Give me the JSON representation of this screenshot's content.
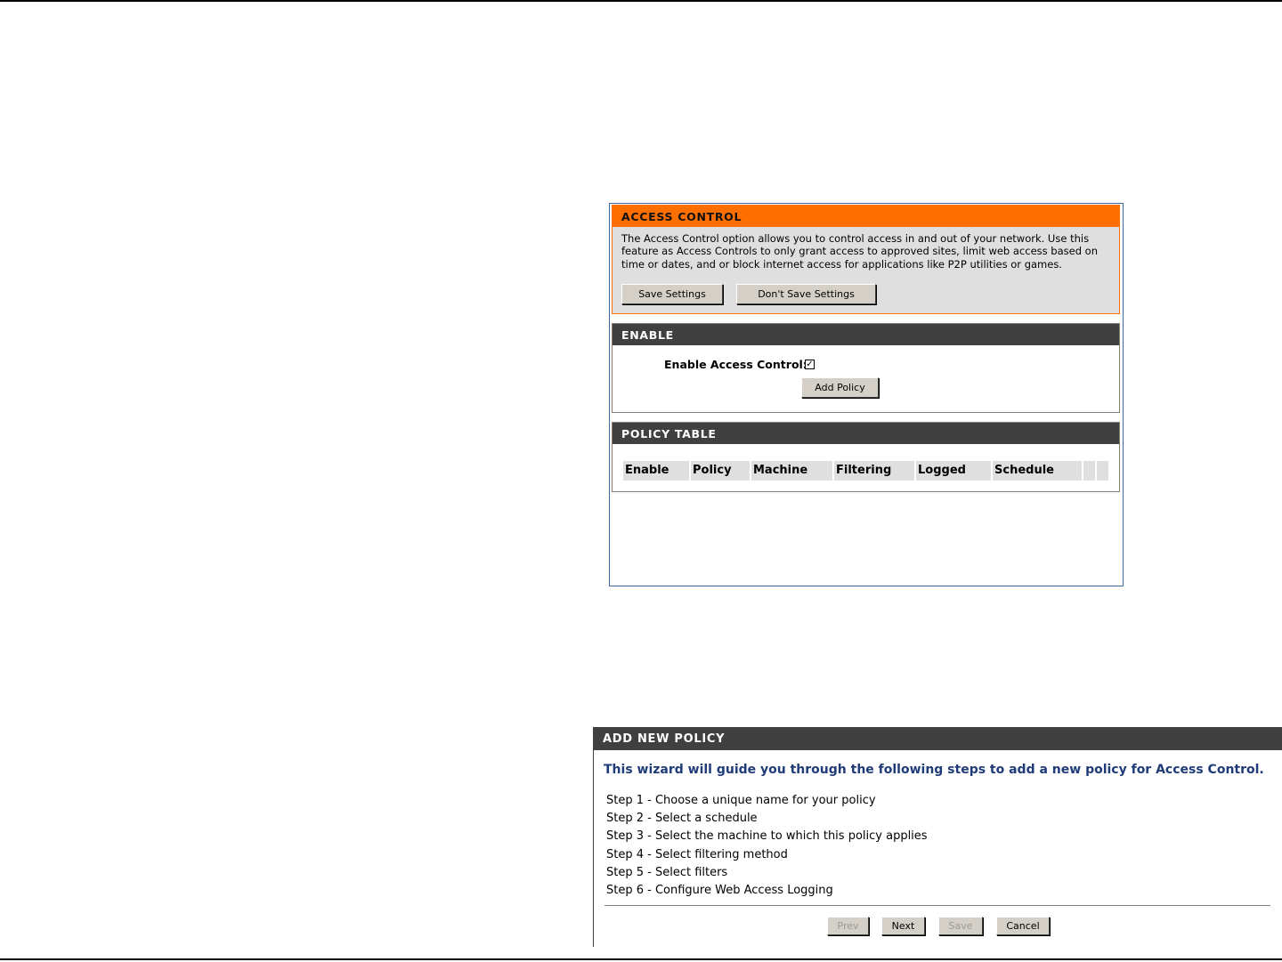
{
  "access_control": {
    "title": "ACCESS CONTROL",
    "description": "The Access Control option allows you to control access in and out of your network. Use this feature as Access Controls to only grant access to approved sites, limit web access based on time or dates, and or block internet access for applications like P2P utilities or games.",
    "save_label": "Save Settings",
    "dont_save_label": "Don't Save Settings"
  },
  "enable": {
    "title": "ENABLE",
    "enable_label": "Enable Access Control:",
    "enable_checked": true,
    "add_policy_label": "Add Policy"
  },
  "policy_table": {
    "title": "POLICY TABLE",
    "columns": [
      "Enable",
      "Policy",
      "Machine",
      "Filtering",
      "Logged",
      "Schedule"
    ]
  },
  "new_policy": {
    "title": "ADD NEW POLICY",
    "intro": "This wizard will guide you through the following steps to add a new policy for Access Control.",
    "steps": [
      "Step 1 - Choose a unique name for your policy",
      "Step 2 - Select a schedule",
      "Step 3 - Select the machine to which this policy applies",
      "Step 4 - Select filtering method",
      "Step 5 - Select filters",
      "Step 6 - Configure Web Access Logging"
    ],
    "prev_label": "Prev",
    "next_label": "Next",
    "save_label": "Save",
    "cancel_label": "Cancel"
  }
}
